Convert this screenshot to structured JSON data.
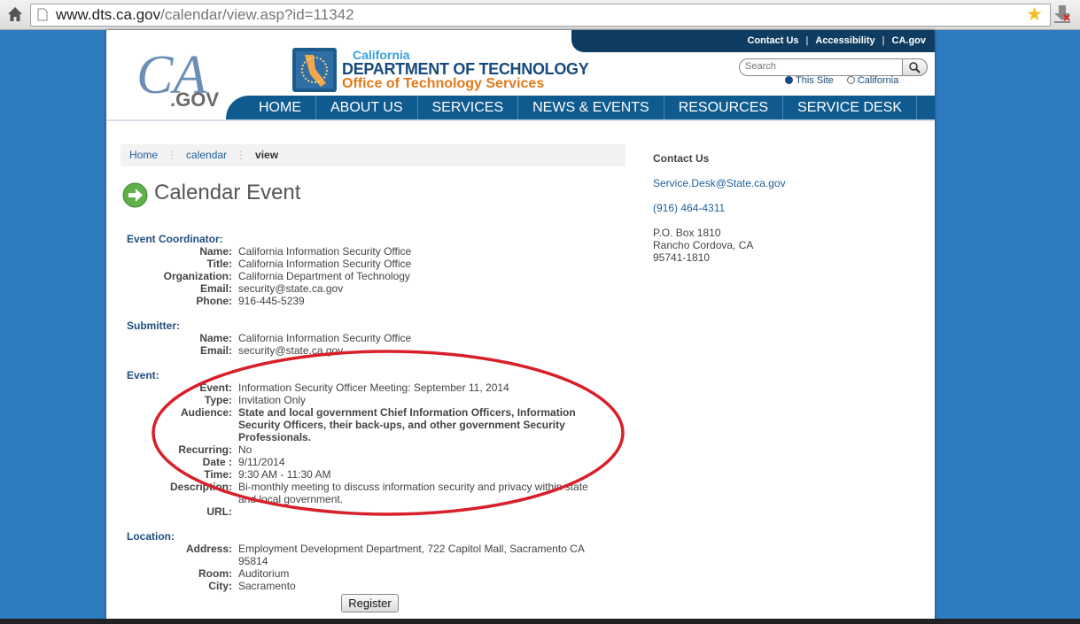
{
  "browser": {
    "url_host": "www.dts.ca.gov",
    "url_path": "/calendar/view.asp?id=11342"
  },
  "topnav": {
    "links": [
      "Contact Us",
      "Accessibility",
      "CA.gov"
    ],
    "separator": "|"
  },
  "logos": {
    "ca_gov": {
      "letters": "CA",
      "suffix": ".GOV"
    },
    "department": {
      "line1": "California",
      "line2": "DEPARTMENT OF TECHNOLOGY",
      "line3": "Office of Technology Services"
    }
  },
  "search": {
    "placeholder": "Search",
    "scope_options": [
      "This Site",
      "California"
    ]
  },
  "mainnav": [
    "HOME",
    "ABOUT US",
    "SERVICES",
    "NEWS & EVENTS",
    "RESOURCES",
    "SERVICE DESK"
  ],
  "breadcrumb": {
    "items": [
      "Home",
      "calendar"
    ],
    "current": "view",
    "divider": "⋮"
  },
  "page_title": "Calendar Event",
  "coordinator": {
    "heading": "Event Coordinator:",
    "name_label": "Name:",
    "name": "California Information Security Office",
    "title_label": "Title:",
    "title": "California Information Security Office",
    "org_label": "Organization:",
    "org": "California Department of Technology",
    "email_label": "Email:",
    "email": "security@state.ca.gov",
    "phone_label": "Phone:",
    "phone": "916-445-5239"
  },
  "submitter": {
    "heading": "Submitter:",
    "name_label": "Name:",
    "name": "California Information Security Office",
    "email_label": "Email:",
    "email": "security@state.ca.gov"
  },
  "event": {
    "heading": "Event:",
    "event_label": "Event:",
    "event": "Information Security Officer Meeting: September 11, 2014",
    "type_label": "Type:",
    "type": "Invitation Only",
    "audience_label": "Audience:",
    "audience_lines": [
      "State and local government Chief Information Officers, Information",
      "Security Officers, their back-ups, and other government Security",
      "Professionals."
    ],
    "recurring_label": "Recurring:",
    "recurring": "No",
    "date_label": "Date :",
    "date": "9/11/2014",
    "time_label": "Time:",
    "time": "9:30 AM - 11:30 AM",
    "description_label": "Description:",
    "description_lines": [
      "Bi-monthly meeting to discuss information security and privacy within state",
      "and local government."
    ],
    "url_label": "URL:"
  },
  "location": {
    "heading": "Location:",
    "address_label": "Address:",
    "address_lines": [
      "Employment Development Department, 722 Capitol Mall, Sacramento CA",
      "95814"
    ],
    "room_label": "Room:",
    "room": "Auditorium",
    "city_label": "City:",
    "city": "Sacramento"
  },
  "register_button": "Register",
  "contact_panel": {
    "heading": "Contact Us",
    "email": "Service.Desk@State.ca.gov",
    "phone": "(916) 464-4311",
    "address_lines": [
      "P.O. Box 1810",
      "Rancho Cordova, CA",
      "95741-1810"
    ]
  },
  "colors": {
    "nav_dark": "#0f3d62",
    "nav_blue": "#0f5b8f",
    "link": "#1f5f9a",
    "annotation_red": "#d8202a",
    "accent_orange": "#e07a1b"
  }
}
